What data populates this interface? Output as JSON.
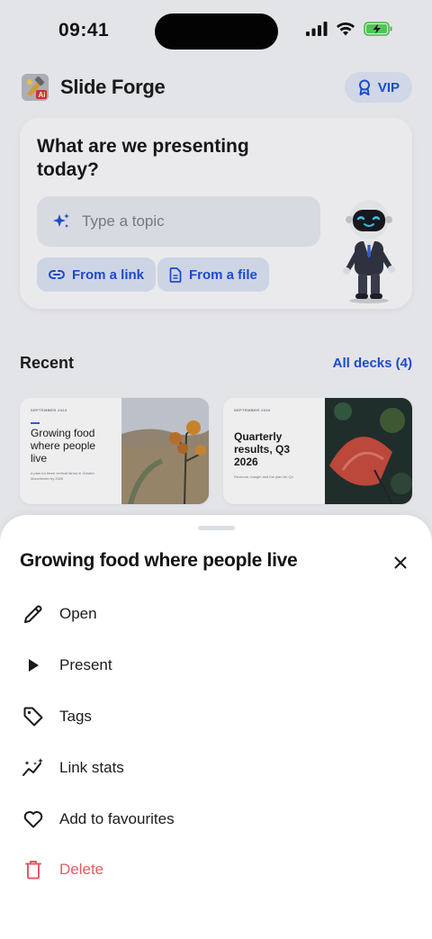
{
  "status_bar": {
    "time": "09:41"
  },
  "header": {
    "app_title": "Slide Forge",
    "vip_label": "VIP"
  },
  "hero": {
    "title": "What are we presenting today?",
    "input_placeholder": "Type a topic",
    "from_link_label": "From a link",
    "from_file_label": "From a file"
  },
  "recent": {
    "title": "Recent",
    "all_decks_label": "All decks (4)"
  },
  "decks": [
    {
      "eyebrow": "SEPTEMBER 2024",
      "title": "Growing food where people live",
      "subtitle": "A plan for three vertical farms in Greater Manchester by 2026"
    },
    {
      "eyebrow": "SEPTEMBER 2026",
      "title": "Quarterly results, Q3 2026",
      "subtitle": "Revenue, margin and the plan for Q4"
    }
  ],
  "sheet": {
    "title": "Growing food where people live",
    "items": [
      {
        "label": "Open",
        "icon": "pencil-icon"
      },
      {
        "label": "Present",
        "icon": "play-icon"
      },
      {
        "label": "Tags",
        "icon": "tag-icon"
      },
      {
        "label": "Link stats",
        "icon": "sparkline-icon"
      },
      {
        "label": "Add to favourites",
        "icon": "heart-icon"
      },
      {
        "label": "Delete",
        "icon": "trash-icon",
        "color": "#e25b63"
      }
    ]
  },
  "colors": {
    "accent": "#1d4ed8",
    "danger": "#e25b63",
    "chip_bg": "#dce4f5"
  }
}
